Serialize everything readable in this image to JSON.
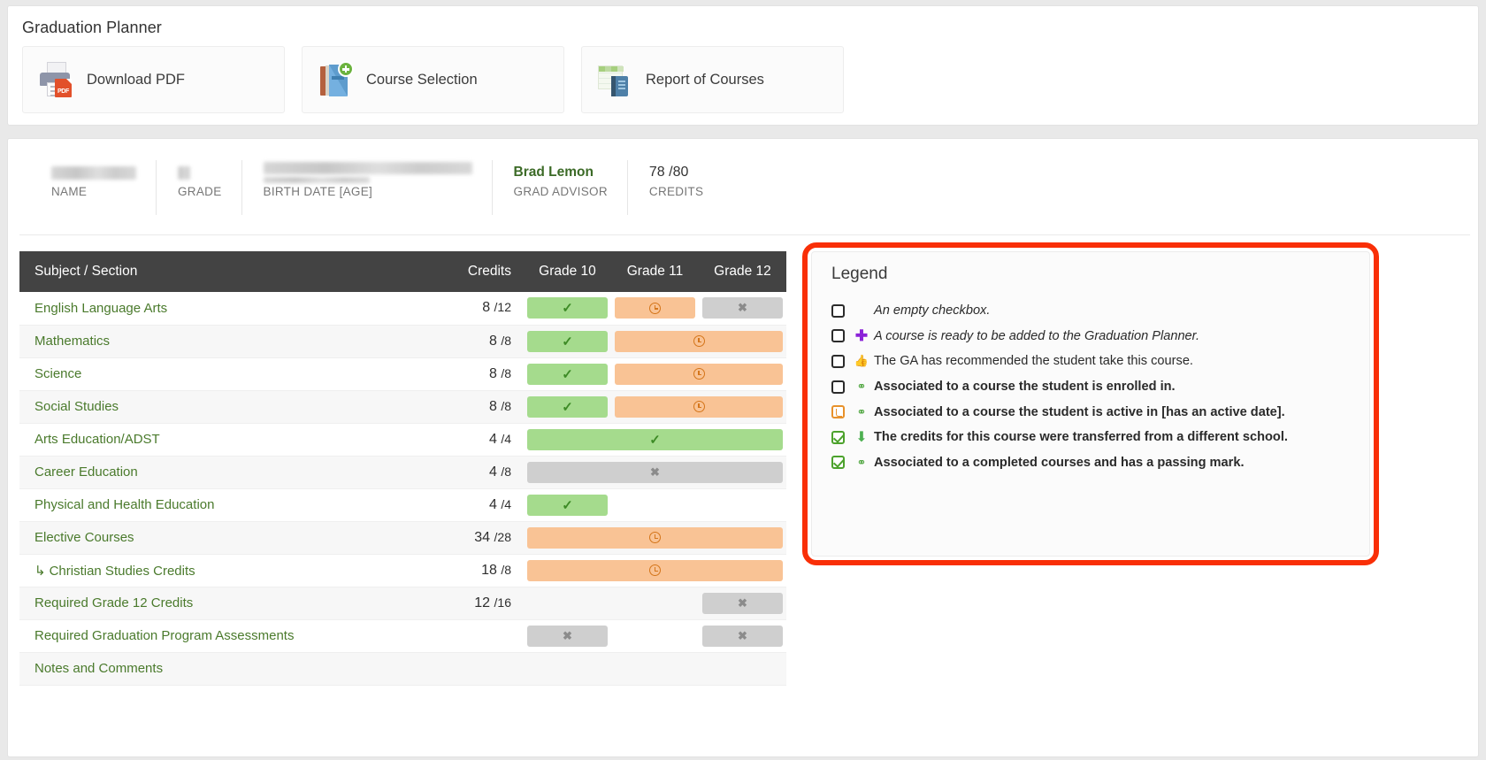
{
  "header": {
    "title": "Graduation Planner",
    "actions": [
      {
        "label": "Download PDF",
        "icon": "printer-pdf-icon"
      },
      {
        "label": "Course Selection",
        "icon": "book-plus-icon"
      },
      {
        "label": "Report of Courses",
        "icon": "report-book-icon"
      }
    ]
  },
  "student": {
    "stats": [
      {
        "key": "NAME",
        "value": "",
        "redacted": true
      },
      {
        "key": "GRADE",
        "value": "",
        "redacted": true
      },
      {
        "key": "BIRTH DATE [AGE]",
        "value": "",
        "redacted": true
      },
      {
        "key": "GRAD ADVISOR",
        "value": "Brad Lemon",
        "redacted": false
      },
      {
        "key": "CREDITS",
        "value": "78 /80",
        "redacted": false
      }
    ]
  },
  "table": {
    "columns": [
      "Subject / Section",
      "Credits",
      "Grade 10",
      "Grade 11",
      "Grade 12"
    ],
    "rows": [
      {
        "subject": "English Language Arts",
        "indent": false,
        "earned": "8",
        "required": "/12",
        "cells": [
          {
            "span": 1,
            "state": "green",
            "icon": "check"
          },
          {
            "span": 1,
            "state": "orange",
            "icon": "clock"
          },
          {
            "span": 1,
            "state": "grey",
            "icon": "x"
          }
        ]
      },
      {
        "subject": "Mathematics",
        "indent": false,
        "earned": "8",
        "required": "/8",
        "cells": [
          {
            "span": 1,
            "state": "green",
            "icon": "check"
          },
          {
            "span": 2,
            "state": "orange",
            "icon": "clock"
          }
        ]
      },
      {
        "subject": "Science",
        "indent": false,
        "earned": "8",
        "required": "/8",
        "cells": [
          {
            "span": 1,
            "state": "green",
            "icon": "check"
          },
          {
            "span": 2,
            "state": "orange",
            "icon": "clock"
          }
        ]
      },
      {
        "subject": "Social Studies",
        "indent": false,
        "earned": "8",
        "required": "/8",
        "cells": [
          {
            "span": 1,
            "state": "green",
            "icon": "check"
          },
          {
            "span": 2,
            "state": "orange",
            "icon": "clock"
          }
        ]
      },
      {
        "subject": "Arts Education/ADST",
        "indent": false,
        "earned": "4",
        "required": "/4",
        "cells": [
          {
            "span": 3,
            "state": "green",
            "icon": "check"
          }
        ]
      },
      {
        "subject": "Career Education",
        "indent": false,
        "earned": "4",
        "required": "/8",
        "cells": [
          {
            "span": 3,
            "state": "grey",
            "icon": "x"
          }
        ]
      },
      {
        "subject": "Physical and Health Education",
        "indent": false,
        "earned": "4",
        "required": "/4",
        "cells": [
          {
            "span": 1,
            "state": "green",
            "icon": "check"
          },
          {
            "span": 1,
            "state": "none",
            "icon": ""
          },
          {
            "span": 1,
            "state": "none",
            "icon": ""
          }
        ]
      },
      {
        "subject": "Elective Courses",
        "indent": false,
        "earned": "34",
        "required": "/28",
        "cells": [
          {
            "span": 3,
            "state": "orange",
            "icon": "clock"
          }
        ]
      },
      {
        "subject": "Christian Studies Credits",
        "indent": true,
        "earned": "18",
        "required": "/8",
        "cells": [
          {
            "span": 3,
            "state": "orange",
            "icon": "clock"
          }
        ]
      },
      {
        "subject": "Required Grade 12 Credits",
        "indent": false,
        "earned": "12",
        "required": "/16",
        "cells": [
          {
            "span": 1,
            "state": "none",
            "icon": ""
          },
          {
            "span": 1,
            "state": "none",
            "icon": ""
          },
          {
            "span": 1,
            "state": "grey",
            "icon": "x"
          }
        ]
      },
      {
        "subject": "Required Graduation Program Assessments",
        "indent": false,
        "earned": "",
        "required": "",
        "cells": [
          {
            "span": 1,
            "state": "grey",
            "icon": "x"
          },
          {
            "span": 1,
            "state": "none",
            "icon": ""
          },
          {
            "span": 1,
            "state": "grey",
            "icon": "x"
          }
        ]
      },
      {
        "subject": "Notes and Comments",
        "indent": false,
        "earned": "",
        "required": "",
        "cells": [
          {
            "span": 1,
            "state": "none",
            "icon": ""
          },
          {
            "span": 1,
            "state": "none",
            "icon": ""
          },
          {
            "span": 1,
            "state": "none",
            "icon": ""
          }
        ]
      }
    ]
  },
  "legend": {
    "title": "Legend",
    "accent_color": "#f92f07",
    "items": [
      {
        "checkbox": "empty",
        "icon": "",
        "icon_name": "",
        "text": "An empty checkbox.",
        "style": "italic"
      },
      {
        "checkbox": "empty",
        "icon": "✚",
        "icon_name": "plus-icon",
        "text": "A course is ready to be added to the Graduation Planner.",
        "style": "italic"
      },
      {
        "checkbox": "empty",
        "icon": "👍",
        "icon_name": "thumbs-up-icon",
        "text": "The GA has recommended the student take this course.",
        "style": "normal"
      },
      {
        "checkbox": "empty",
        "icon": "🔗",
        "icon_name": "link-icon",
        "text": "Associated to a course the student is enrolled in.",
        "style": "bold"
      },
      {
        "checkbox": "clock",
        "icon": "🔗",
        "icon_name": "link-icon",
        "text": "Associated to a course the student is active in [has an active date].",
        "style": "bold"
      },
      {
        "checkbox": "checked",
        "icon": "⬇",
        "icon_name": "download-arrow-icon",
        "text": "The credits for this course were transferred from a different school.",
        "style": "bold"
      },
      {
        "checkbox": "checked",
        "icon": "🔗",
        "icon_name": "link-icon",
        "text": "Associated to a completed courses and has a passing mark.",
        "style": "bold"
      }
    ]
  },
  "colors": {
    "green_badge": "#a5db8d",
    "orange_badge": "#f9c395",
    "grey_badge": "#cfcfcf",
    "header_dark": "#434343",
    "subject_green": "#4a7a2c",
    "legend_outline": "#f92f07"
  }
}
